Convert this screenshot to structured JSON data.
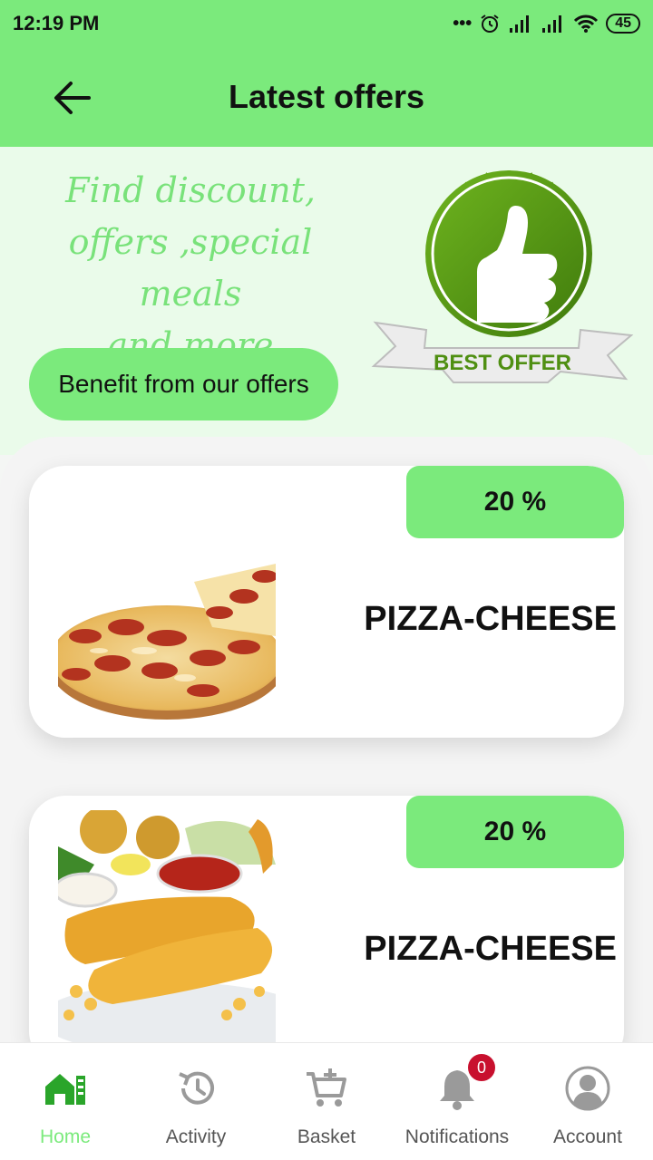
{
  "status_bar": {
    "time": "12:19 PM",
    "battery": "45"
  },
  "header": {
    "title": "Latest offers"
  },
  "hero": {
    "tagline_lines": [
      "Find discount,",
      "offers ,special meals",
      "and more"
    ],
    "button_label": "Benefit from our offers",
    "badge_text": "BEST OFFER"
  },
  "offers": [
    {
      "discount": "20 %",
      "name": "PIZZA-CHEESE",
      "image": "pizza-image"
    },
    {
      "discount": "20 %",
      "name": "PIZZA-CHEESE",
      "image": "fish-and-chips-image"
    }
  ],
  "bottom_nav": {
    "items": [
      {
        "label": "Home",
        "icon": "home-icon",
        "active": true
      },
      {
        "label": "Activity",
        "icon": "history-icon"
      },
      {
        "label": "Basket",
        "icon": "basket-add-icon"
      },
      {
        "label": "Notifications",
        "icon": "bell-icon",
        "badge": "0"
      },
      {
        "label": "Account",
        "icon": "account-icon"
      }
    ]
  },
  "colors": {
    "accent": "#7bea7c",
    "hero_bg": "#eafbea",
    "badge_red": "#c8102e",
    "badge_green": "#4f8f12"
  }
}
